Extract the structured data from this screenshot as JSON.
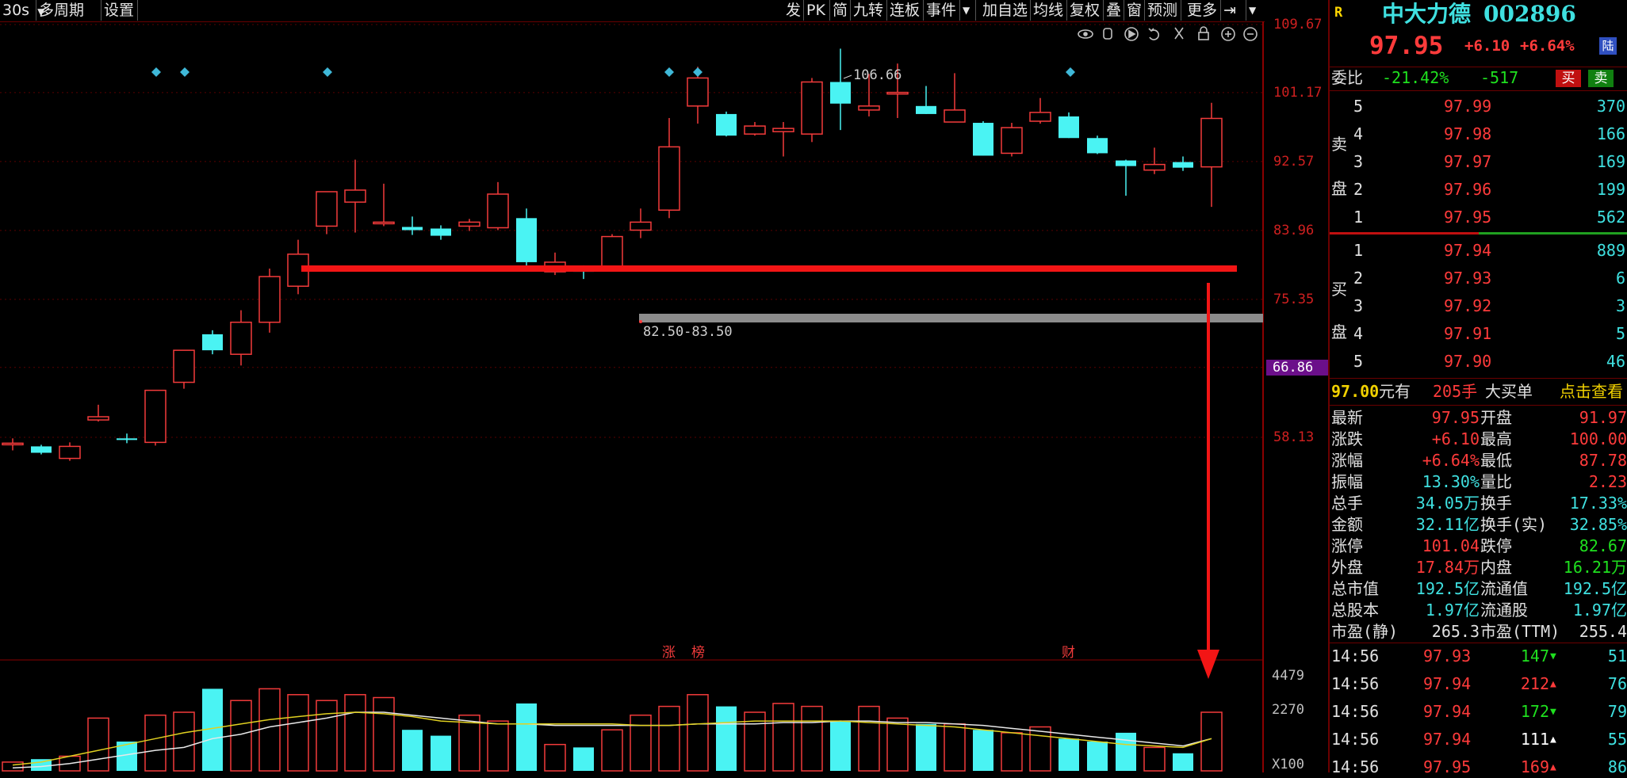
{
  "toolbar": {
    "period": "30s",
    "left_items": [
      "多周期",
      "设置"
    ],
    "right_items": [
      "发",
      "PK",
      "简",
      "九转",
      "连板",
      "事件",
      "加自选",
      "均线",
      "复权",
      "叠",
      "窗",
      "预测",
      "更多"
    ]
  },
  "chart_data": {
    "type": "candlestick",
    "y_axis_labels": [
      "109.67",
      "101.17",
      "92.57",
      "83.96",
      "75.35",
      "66.86",
      "58.13"
    ],
    "current_marker": "66.86",
    "vol_axis_labels": [
      "4479",
      "2270",
      "X100"
    ],
    "high_annotation": "106.66",
    "zone_annotation": "82.50-83.50",
    "event_marks": [
      "涨",
      "榜",
      "财"
    ],
    "candles": [
      {
        "o": 57.3,
        "h": 58.0,
        "l": 56.5,
        "c": 57.4
      },
      {
        "o": 57.0,
        "h": 57.2,
        "l": 56.0,
        "c": 56.2
      },
      {
        "o": 55.5,
        "h": 57.5,
        "l": 55.2,
        "c": 57.0
      },
      {
        "o": 60.3,
        "h": 62.2,
        "l": 60.1,
        "c": 60.7
      },
      {
        "o": 58.0,
        "h": 58.6,
        "l": 57.4,
        "c": 57.8
      },
      {
        "o": 57.5,
        "h": 64.0,
        "l": 57.1,
        "c": 64.0
      },
      {
        "o": 65.0,
        "h": 69.0,
        "l": 64.2,
        "c": 69.0
      },
      {
        "o": 71.0,
        "h": 71.5,
        "l": 68.5,
        "c": 69.0
      },
      {
        "o": 68.5,
        "h": 74.0,
        "l": 67.1,
        "c": 72.5
      },
      {
        "o": 72.5,
        "h": 79.2,
        "l": 71.2,
        "c": 78.2
      },
      {
        "o": 77.0,
        "h": 82.8,
        "l": 76.0,
        "c": 81.0
      },
      {
        "o": 84.5,
        "h": 88.8,
        "l": 83.5,
        "c": 88.8
      },
      {
        "o": 87.5,
        "h": 92.8,
        "l": 83.7,
        "c": 89.0
      },
      {
        "o": 84.8,
        "h": 89.8,
        "l": 84.5,
        "c": 85.0
      },
      {
        "o": 84.4,
        "h": 85.7,
        "l": 83.4,
        "c": 84.0
      },
      {
        "o": 84.2,
        "h": 84.6,
        "l": 82.8,
        "c": 83.3
      },
      {
        "o": 84.5,
        "h": 85.4,
        "l": 83.9,
        "c": 85.0
      },
      {
        "o": 84.3,
        "h": 90.0,
        "l": 84.0,
        "c": 88.5
      },
      {
        "o": 85.5,
        "h": 86.7,
        "l": 79.6,
        "c": 80.0
      },
      {
        "o": 78.8,
        "h": 81.2,
        "l": 78.4,
        "c": 80.0
      },
      {
        "o": 79.2,
        "h": 79.6,
        "l": 77.9,
        "c": 78.8
      },
      {
        "o": 79.5,
        "h": 83.5,
        "l": 78.9,
        "c": 83.2
      },
      {
        "o": 84.0,
        "h": 86.7,
        "l": 83.0,
        "c": 85.0
      },
      {
        "o": 86.5,
        "h": 98.0,
        "l": 85.5,
        "c": 94.4
      },
      {
        "o": 99.5,
        "h": 104.4,
        "l": 97.3,
        "c": 103.0
      },
      {
        "o": 98.5,
        "h": 98.8,
        "l": 95.7,
        "c": 95.8
      },
      {
        "o": 96.0,
        "h": 97.5,
        "l": 95.8,
        "c": 97.0
      },
      {
        "o": 96.3,
        "h": 97.5,
        "l": 93.2,
        "c": 96.7
      },
      {
        "o": 96.0,
        "h": 103.0,
        "l": 95.0,
        "c": 102.5
      },
      {
        "o": 102.5,
        "h": 106.66,
        "l": 96.5,
        "c": 99.8
      },
      {
        "o": 99.0,
        "h": 103.5,
        "l": 98.2,
        "c": 99.5
      },
      {
        "o": 101.0,
        "h": 104.8,
        "l": 98.0,
        "c": 101.2
      },
      {
        "o": 99.5,
        "h": 102.0,
        "l": 98.5,
        "c": 98.5
      },
      {
        "o": 97.5,
        "h": 103.6,
        "l": 97.5,
        "c": 99.0
      },
      {
        "o": 97.4,
        "h": 97.6,
        "l": 93.3,
        "c": 93.3
      },
      {
        "o": 93.6,
        "h": 97.4,
        "l": 93.2,
        "c": 96.8
      },
      {
        "o": 97.6,
        "h": 100.5,
        "l": 97.3,
        "c": 98.7
      },
      {
        "o": 98.2,
        "h": 98.7,
        "l": 95.5,
        "c": 95.5
      },
      {
        "o": 95.5,
        "h": 95.8,
        "l": 93.5,
        "c": 93.6
      },
      {
        "o": 92.7,
        "h": 92.8,
        "l": 88.3,
        "c": 92.0
      },
      {
        "o": 91.5,
        "h": 94.3,
        "l": 91.0,
        "c": 92.2
      },
      {
        "o": 92.5,
        "h": 93.2,
        "l": 91.4,
        "c": 91.8
      },
      {
        "o": 91.9,
        "h": 99.9,
        "l": 86.9,
        "c": 97.95
      }
    ],
    "volumes": [
      3,
      4,
      5,
      18,
      10,
      19,
      20,
      28,
      24,
      28,
      26,
      24,
      26,
      25,
      14,
      12,
      19,
      17,
      23,
      9,
      8,
      14,
      19,
      22,
      26,
      22,
      20,
      23,
      22,
      17,
      22,
      18,
      16,
      16,
      14,
      13,
      15,
      11,
      10,
      13,
      8,
      6,
      20
    ],
    "ma_white": [
      1,
      1.5,
      2.5,
      4,
      5.5,
      7,
      8,
      11,
      12.5,
      15,
      16.5,
      18,
      20,
      20,
      19,
      18,
      17,
      16,
      16,
      15.5,
      15.5,
      15.5,
      15.5,
      15.5,
      16,
      16,
      16,
      16.5,
      16.5,
      17,
      17,
      16.5,
      16.5,
      16,
      15.5,
      14.5,
      13.5,
      12.5,
      11.5,
      10.5,
      9.5,
      8.5,
      11
    ],
    "ma_yellow": [
      2,
      3,
      5,
      7,
      9,
      11,
      13,
      14.5,
      16,
      17.5,
      18.5,
      19.5,
      20,
      19.5,
      18.5,
      17,
      16.5,
      16,
      16,
      16,
      16,
      16,
      15.5,
      15.5,
      16,
      16.5,
      17,
      17,
      17,
      17,
      16.5,
      16,
      15.5,
      15,
      14,
      13,
      12,
      11,
      10,
      9,
      8.5,
      8,
      11
    ]
  },
  "stock": {
    "badge": "R",
    "name": "中大力德",
    "code": "002896",
    "price": "97.95",
    "change": "+6.10",
    "change_pct": "+6.64%",
    "market_tag": "陆",
    "wei_bi_label": "委比",
    "wei_bi": "-21.42%",
    "wei_cha": "-517",
    "buy_btn": "买",
    "sell_btn": "卖"
  },
  "asks": {
    "label_top": "卖",
    "label_bottom": "盘",
    "rows": [
      {
        "n": "5",
        "p": "97.99",
        "v": "370"
      },
      {
        "n": "4",
        "p": "97.98",
        "v": "166"
      },
      {
        "n": "3",
        "p": "97.97",
        "v": "169"
      },
      {
        "n": "2",
        "p": "97.96",
        "v": "199"
      },
      {
        "n": "1",
        "p": "97.95",
        "v": "562"
      }
    ]
  },
  "bids": {
    "label_top": "买",
    "label_bottom": "盘",
    "rows": [
      {
        "n": "1",
        "p": "97.94",
        "v": "889"
      },
      {
        "n": "2",
        "p": "97.93",
        "v": "6"
      },
      {
        "n": "3",
        "p": "97.92",
        "v": "3"
      },
      {
        "n": "4",
        "p": "97.91",
        "v": "5"
      },
      {
        "n": "5",
        "p": "97.90",
        "v": "46"
      }
    ]
  },
  "big_order": {
    "price": "97.00",
    "unit": "元有",
    "lots": "205手",
    "text": "大买单",
    "link": "点击查看"
  },
  "stats": [
    {
      "l1": "最新",
      "v1": "97.95",
      "c1": "r",
      "l2": "开盘",
      "v2": "91.97",
      "c2": "r"
    },
    {
      "l1": "涨跌",
      "v1": "+6.10",
      "c1": "r",
      "l2": "最高",
      "v2": "100.00",
      "c2": "r"
    },
    {
      "l1": "涨幅",
      "v1": "+6.64%",
      "c1": "r",
      "l2": "最低",
      "v2": "87.78",
      "c2": "r"
    },
    {
      "l1": "振幅",
      "v1": "13.30%",
      "c1": "c",
      "l2": "量比",
      "v2": "2.23",
      "c2": "r"
    },
    {
      "l1": "总手",
      "v1": "34.05万",
      "c1": "c",
      "l2": "换手",
      "v2": "17.33%",
      "c2": "c"
    },
    {
      "l1": "金额",
      "v1": "32.11亿",
      "c1": "c",
      "l2": "换手(实)",
      "v2": "32.85%",
      "c2": "c"
    },
    {
      "l1": "涨停",
      "v1": "101.04",
      "c1": "r",
      "l2": "跌停",
      "v2": "82.67",
      "c2": "g"
    },
    {
      "l1": "外盘",
      "v1": "17.84万",
      "c1": "r",
      "l2": "内盘",
      "v2": "16.21万",
      "c2": "g"
    },
    {
      "l1": "总市值",
      "v1": "192.5亿",
      "c1": "c",
      "l2": "流通值",
      "v2": "192.5亿",
      "c2": "c"
    },
    {
      "l1": "总股本",
      "v1": "1.97亿",
      "c1": "c",
      "l2": "流通股",
      "v2": "1.97亿",
      "c2": "c"
    },
    {
      "l1": "市盈(静)",
      "v1": "265.3",
      "c1": "w",
      "l2": "市盈(TTM)",
      "v2": "255.4",
      "c2": "w"
    }
  ],
  "ticks": [
    {
      "t": "14:56",
      "p": "97.93",
      "v": "147",
      "dir": "down",
      "n": "51"
    },
    {
      "t": "14:56",
      "p": "97.94",
      "v": "212",
      "dir": "up",
      "n": "76"
    },
    {
      "t": "14:56",
      "p": "97.94",
      "v": "172",
      "dir": "down",
      "n": "79"
    },
    {
      "t": "14:56",
      "p": "97.94",
      "v": "111",
      "dir": "up-white",
      "n": "55"
    },
    {
      "t": "14:56",
      "p": "97.95",
      "v": "169",
      "dir": "up",
      "n": "86"
    }
  ]
}
